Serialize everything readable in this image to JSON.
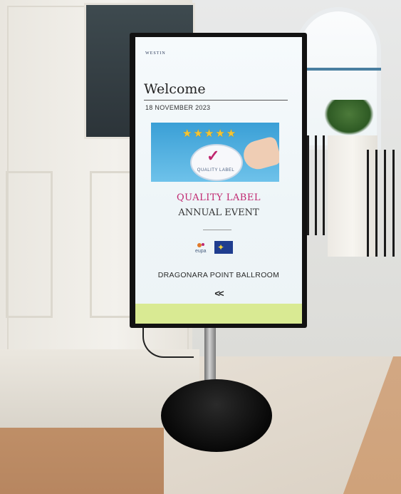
{
  "screen": {
    "brand": "WESTIN",
    "welcome": "Welcome",
    "date": "18 NOVEMBER 2023",
    "banner_label": "QUALITY LABEL",
    "stars": "★★★★★",
    "event_title_1": "QUALITY LABEL",
    "event_title_2": "ANNUAL EVENT",
    "logo_text": "eupa",
    "venue": "DRAGONARA POINT BALLROOM",
    "arrow": "<<"
  },
  "colors": {
    "accent": "#c0276f",
    "footer": "#d9ea93",
    "banner": "#3a9fd6"
  }
}
